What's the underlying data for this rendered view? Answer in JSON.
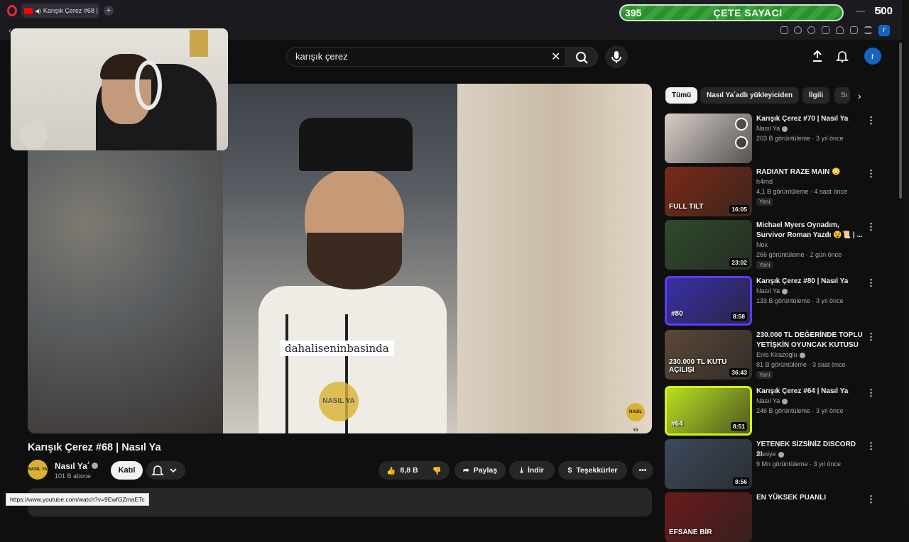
{
  "browser": {
    "tab_title": "Karışık Çerez #68 | Na",
    "status_url": "https://www.youtube.com/watch?v=9EwfGZmaETc",
    "profile_initial": "r"
  },
  "overlay": {
    "counter_left": "395",
    "counter_label": "ÇETE SAYACI",
    "counter_right": "500"
  },
  "header": {
    "search_value": "karışık çerez",
    "avatar_initial": "r"
  },
  "video": {
    "subtitle": "dahaliseninbasinda",
    "watermark": "NASIL YA",
    "title": "Karışık Çerez #68 | Nasıl Ya",
    "channel_name": "Nasıl Yaؗ",
    "channel_subs": "101 B abone",
    "channel_avatar_text": "NASIL YA"
  },
  "actions": {
    "join": "Katıl",
    "likes": "8,8 B",
    "share": "Paylaş",
    "download": "İndir",
    "thanks": "Teşekkürler"
  },
  "chips": [
    "Tümü",
    "Nasıl Yaؗ adlı yükleyiciden",
    "İlgili",
    "Sı"
  ],
  "recommendations": [
    {
      "title": "Karışık Çerez #70 | Nasıl Ya",
      "channel": "Nasıl Yaؗ",
      "meta": "203 B görüntüleme · 3 yıl önce",
      "duration": "",
      "badge": "",
      "verified": true,
      "thumb_color": "#d8cfc9"
    },
    {
      "title": "RADIANT RAZE MAIN 😳",
      "channel": "h4rnd",
      "meta": "4,1 B görüntüleme · 4 saat önce",
      "duration": "16:05",
      "badge": "Yeni",
      "verified": false,
      "thumb_color": "#7a2a16"
    },
    {
      "title": "Michael Myers Oynadım, Survivor Roman Yazdı 😵📜 | ...",
      "channel": "Nox",
      "meta": "266 görüntüleme · 2 gün önce",
      "duration": "23:02",
      "badge": "Yeni",
      "verified": false,
      "thumb_color": "#2f4a2a"
    },
    {
      "title": "Karışık Çerez #80 | Nasıl Ya",
      "channel": "Nasıl Yaؗ",
      "meta": "133 B görüntüleme · 3 yıl önce",
      "duration": "8:58",
      "badge": "",
      "verified": true,
      "thumb_color": "#3a2fa8"
    },
    {
      "title": "230.000 TL DEĞERİNDE TOPLU YETİŞKİN OYUNCAK KUTUSU ...",
      "channel": "Enis Kirazoglu",
      "meta": "81 B görüntüleme · 3 saat önce",
      "duration": "36:43",
      "badge": "Yeni",
      "verified": true,
      "thumb_color": "#5a4838"
    },
    {
      "title": "Karışık Çerez #64 | Nasıl Ya",
      "channel": "Nasıl Yaؗ",
      "meta": "246 B görüntüleme · 3 yıl önce",
      "duration": "8:51",
      "badge": "",
      "verified": true,
      "thumb_color": "#b8e020"
    },
    {
      "title": "YETENEK SİZSİNİZ DISCORD 2!",
      "channel": "Saniye",
      "meta": "9 Mn görüntüleme · 3 yıl önce",
      "duration": "8:56",
      "badge": "",
      "verified": true,
      "thumb_color": "#3d4a5a"
    },
    {
      "title": "EN YÜKSEK PUANLI",
      "channel": "",
      "meta": "",
      "duration": "",
      "badge": "",
      "verified": false,
      "thumb_color": "#6a1a1a"
    }
  ],
  "thumb_overlays": {
    "rec3_text": "#80",
    "rec4_text": "230.000 TL KUTU AÇILIŞI",
    "rec5_text": "#64",
    "rec2_text": "FULL TILT",
    "rec8_text": "EFSANE BİR"
  }
}
